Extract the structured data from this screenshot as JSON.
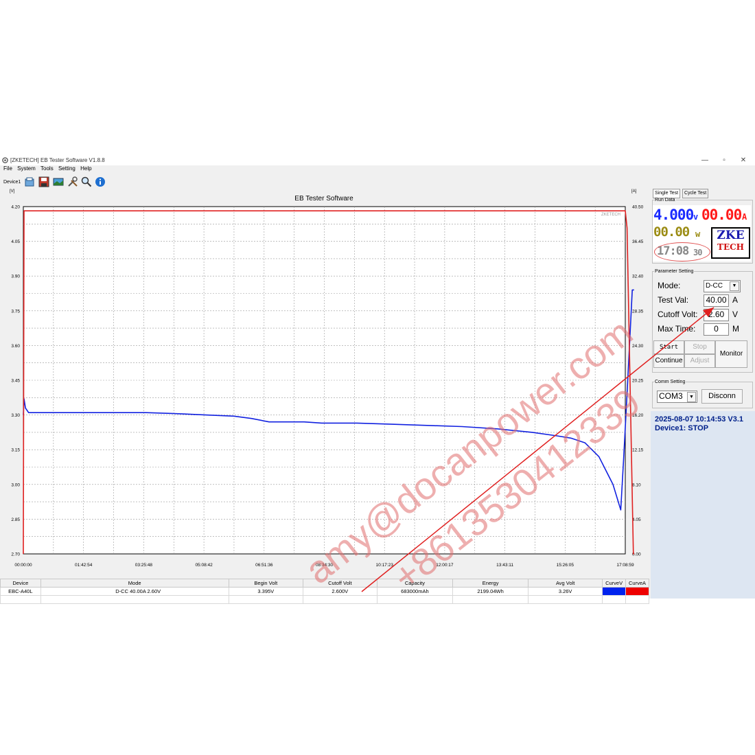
{
  "window": {
    "title": "[ZKETECH] EB Tester Software V1.8.8",
    "minimize": "—",
    "maximize": "▫",
    "close": "✕"
  },
  "menu": [
    "File",
    "System",
    "Tools",
    "Setting",
    "Help"
  ],
  "toolbar": {
    "device_label": "Device1",
    "icons": [
      "open-icon",
      "save-icon",
      "image-icon",
      "tools-icon",
      "search-icon",
      "info-icon"
    ]
  },
  "chart_data": {
    "type": "line",
    "title": "EB Tester Software",
    "brand_mark": "ZKETECH",
    "ylabel_left": "[V]",
    "ylabel_right": "[A]",
    "y_left_ticks": [
      "4.20",
      "4.05",
      "3.90",
      "3.75",
      "3.60",
      "3.45",
      "3.30",
      "3.15",
      "3.00",
      "2.85",
      "2.70"
    ],
    "y_right_ticks": [
      "40.50",
      "36.45",
      "32.40",
      "28.35",
      "24.30",
      "20.25",
      "16.20",
      "12.15",
      "8.10",
      "4.05",
      "0.00"
    ],
    "x_ticks": [
      "00:00:00",
      "01:42:54",
      "03:25:48",
      "05:08:42",
      "06:51:36",
      "08:34:30",
      "10:17:23",
      "12:00:17",
      "13:43:11",
      "15:26:05",
      "17:08:59"
    ],
    "ylim_left": [
      2.7,
      4.2
    ],
    "ylim_right": [
      0.0,
      40.5
    ],
    "xlim_hours": [
      0,
      17.15
    ],
    "grid": true,
    "series": [
      {
        "name": "CurveV",
        "color": "#1020e0",
        "axis": "left",
        "points": [
          [
            0.0,
            3.3
          ],
          [
            0.02,
            3.37
          ],
          [
            0.06,
            3.33
          ],
          [
            0.15,
            3.31
          ],
          [
            1.5,
            3.31
          ],
          [
            3.5,
            3.31
          ],
          [
            4.5,
            3.305
          ],
          [
            5.2,
            3.3
          ],
          [
            6.0,
            3.295
          ],
          [
            6.5,
            3.285
          ],
          [
            7.0,
            3.27
          ],
          [
            8.0,
            3.27
          ],
          [
            8.5,
            3.265
          ],
          [
            9.5,
            3.265
          ],
          [
            10.5,
            3.26
          ],
          [
            11.5,
            3.255
          ],
          [
            12.5,
            3.25
          ],
          [
            13.5,
            3.24
          ],
          [
            14.5,
            3.225
          ],
          [
            15.2,
            3.21
          ],
          [
            15.6,
            3.2
          ],
          [
            16.0,
            3.18
          ],
          [
            16.4,
            3.12
          ],
          [
            16.8,
            3.0
          ],
          [
            17.02,
            2.89
          ],
          [
            17.1,
            3.1
          ],
          [
            17.22,
            3.45
          ],
          [
            17.35,
            3.84
          ],
          [
            17.4,
            3.84
          ]
        ]
      },
      {
        "name": "CurveA",
        "color": "#e02020",
        "axis": "right",
        "points": [
          [
            0.0,
            0.0
          ],
          [
            0.02,
            40.0
          ],
          [
            17.15,
            40.0
          ],
          [
            17.2,
            38.0
          ],
          [
            17.38,
            0.0
          ],
          [
            17.4,
            0.0
          ]
        ]
      }
    ]
  },
  "results_table": {
    "headers": [
      "Device",
      "Mode",
      "Begin Volt",
      "Cutoff Volt",
      "Capacity",
      "Energy",
      "Avg Volt",
      "CurveV",
      "CurveA"
    ],
    "row": [
      "EBC-A40L",
      "D-CC  40.00A  2.60V",
      "3.395V",
      "2.600V",
      "683000mAh",
      "2199.04Wh",
      "3.26V"
    ],
    "curve_colors": [
      "#0022ee",
      "#ee0000"
    ]
  },
  "panel": {
    "tabs": [
      "Single Test",
      "Cycle Test"
    ],
    "run_data_label": "Run Data",
    "voltage": "4.000",
    "voltage_unit": "v",
    "current": "00.00",
    "current_unit": "A",
    "power": "00.00",
    "power_unit": "w",
    "elapsed": "17:08",
    "elapsed_sec": "30",
    "logo_top": "ZKE",
    "logo_bottom": "TECH",
    "parameter_label": "Parameter Setting",
    "mode_label": "Mode:",
    "mode_value": "D-CC",
    "test_val_label": "Test Val:",
    "test_val": "40.00",
    "test_val_unit": "A",
    "cutoff_label": "Cutoff Volt:",
    "cutoff_value": "2.60",
    "cutoff_unit": "V",
    "max_time_label": "Max Time:",
    "max_time": "0",
    "max_time_unit": "M",
    "start_label": "Start",
    "stop_label": "Stop",
    "continue_label": "Continue",
    "adjust_label": "Adjust",
    "monitor_label": "Monitor",
    "comm_label": "Comm Setting",
    "port": "COM3",
    "disconn_label": "Disconn",
    "status_line1": "2025-08-07  10:14:53  V3.1",
    "status_line2": "Device1: STOP"
  },
  "watermark": {
    "line1": "amy@docanpower.com",
    "line2": "+8613530412339"
  }
}
